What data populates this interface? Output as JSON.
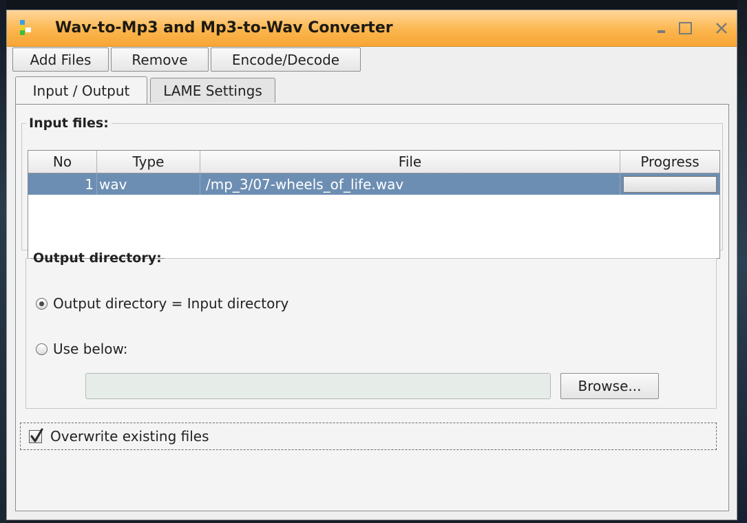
{
  "window": {
    "title": "Wav-to-Mp3 and Mp3-to-Wav Converter",
    "icons": {
      "app": "app-icon",
      "minimize": "minimize-icon",
      "maximize": "maximize-icon",
      "close": "close-icon"
    }
  },
  "toolbar": {
    "add_files": "Add Files",
    "remove": "Remove",
    "encode_decode": "Encode/Decode"
  },
  "tabs": [
    {
      "label": "Input / Output",
      "active": true
    },
    {
      "label": "LAME Settings",
      "active": false
    }
  ],
  "input_files": {
    "legend": "Input files:",
    "columns": [
      "No",
      "Type",
      "File",
      "Progress"
    ],
    "rows": [
      {
        "no": "1",
        "type": "wav",
        "file": "/mp_3/07-wheels_of_life.wav",
        "progress": 0
      }
    ]
  },
  "output_directory": {
    "legend": "Output directory:",
    "option_same": "Output directory = Input directory",
    "option_below": "Use below:",
    "selected": "same",
    "path_value": "",
    "browse_label": "Browse..."
  },
  "overwrite": {
    "label": "Overwrite existing files",
    "checked": true
  },
  "colors": {
    "titlebar": "#f7a535",
    "selection": "#6d8eb3"
  }
}
